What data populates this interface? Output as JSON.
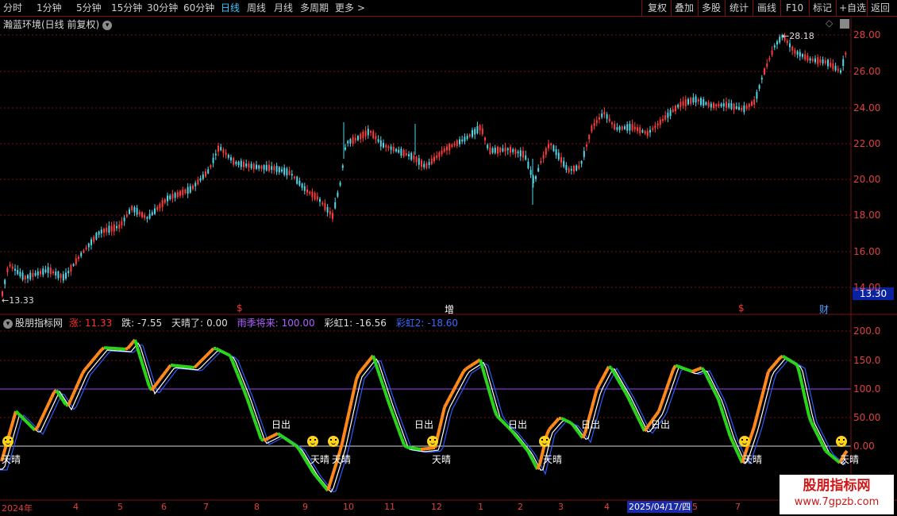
{
  "toolbar": {
    "periods": [
      "分时",
      "1分钟",
      "5分钟",
      "15分钟",
      "30分钟",
      "60分钟",
      "日线",
      "周线",
      "月线",
      "多周期",
      "更多"
    ],
    "active_period": "日线",
    "more_arrow": ">",
    "right_buttons": [
      "复权",
      "叠加",
      "多股",
      "统计",
      "画线",
      "F10",
      "标记",
      "+自选",
      "返回"
    ]
  },
  "price_panel": {
    "title": "瀚蓝环境(日线 前复权)",
    "high_label": "28.18",
    "low_label": "←13.33",
    "last_price": "13.30",
    "y_ticks": [
      "28.00",
      "26.00",
      "24.00",
      "22.00",
      "20.00",
      "18.00",
      "16.00",
      "14.00"
    ],
    "markers": [
      {
        "text": "$",
        "color": "#ff3030"
      },
      {
        "text": "增",
        "color": "#ffffff"
      },
      {
        "text": "$",
        "color": "#ff3030"
      },
      {
        "text": "财",
        "color": "#4aa0ff"
      }
    ]
  },
  "indicator_panel": {
    "title": "股朋指标网",
    "readouts": [
      {
        "label": "涨:",
        "value": "11.33",
        "color": "#ff3030"
      },
      {
        "label": "跌:",
        "value": "-7.55",
        "color": "#ffffff"
      },
      {
        "label": "天晴了:",
        "value": "0.00",
        "color": "#ffffff"
      },
      {
        "label": "雨季将来:",
        "value": "100.00",
        "color": "#b060ff"
      },
      {
        "label": "彩虹1:",
        "value": "-16.56",
        "color": "#ffffff"
      },
      {
        "label": "彩虹2:",
        "value": "-18.60",
        "color": "#3a6aff"
      }
    ],
    "y_ticks": [
      "200.0",
      "150.0",
      "100.0",
      "50.00",
      "0.00"
    ],
    "signals": {
      "sunrise": "日出",
      "sunny": "天晴"
    }
  },
  "date_axis": {
    "labels": [
      "2024年",
      "4",
      "5",
      "6",
      "7",
      "8",
      "9",
      "10",
      "11",
      "12",
      "1",
      "2",
      "3",
      "4",
      "5",
      "6",
      "7"
    ],
    "highlight": "2025/04/17/四"
  },
  "watermark": {
    "main": "股朋指标网",
    "url": "www.7gpzb.com"
  },
  "colors": {
    "up": "#ff3b3b",
    "down": "#4fd6e8",
    "grid": "#7a1010",
    "axis_text": "#e04040",
    "rainbow1": "#ffffff",
    "rainbow2": "#2a5aff",
    "rain_line": "#a040ff"
  }
}
